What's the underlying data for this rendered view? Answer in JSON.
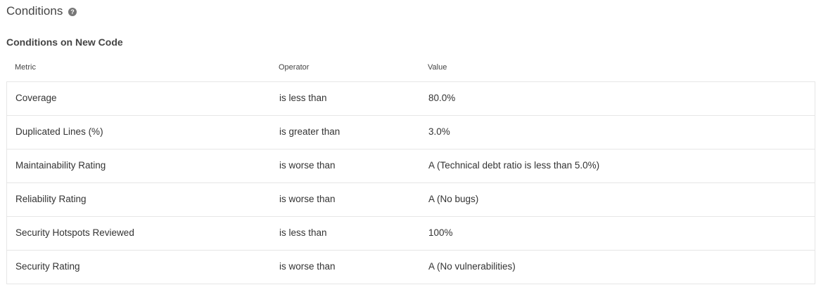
{
  "header": {
    "title": "Conditions",
    "help_icon": "question-circle-icon"
  },
  "section": {
    "subtitle": "Conditions on New Code"
  },
  "table": {
    "columns": {
      "metric": "Metric",
      "operator": "Operator",
      "value": "Value"
    },
    "rows": [
      {
        "metric": "Coverage",
        "operator": "is less than",
        "value": "80.0%"
      },
      {
        "metric": "Duplicated Lines (%)",
        "operator": "is greater than",
        "value": "3.0%"
      },
      {
        "metric": "Maintainability Rating",
        "operator": "is worse than",
        "value": "A  (Technical debt ratio is less than 5.0%)"
      },
      {
        "metric": "Reliability Rating",
        "operator": "is worse than",
        "value": "A  (No bugs)"
      },
      {
        "metric": "Security Hotspots Reviewed",
        "operator": "is less than",
        "value": "100%"
      },
      {
        "metric": "Security Rating",
        "operator": "is worse than",
        "value": "A  (No vulnerabilities)"
      }
    ]
  },
  "colors": {
    "text": "#333333",
    "border": "#e6e6e6",
    "icon": "#777777"
  }
}
